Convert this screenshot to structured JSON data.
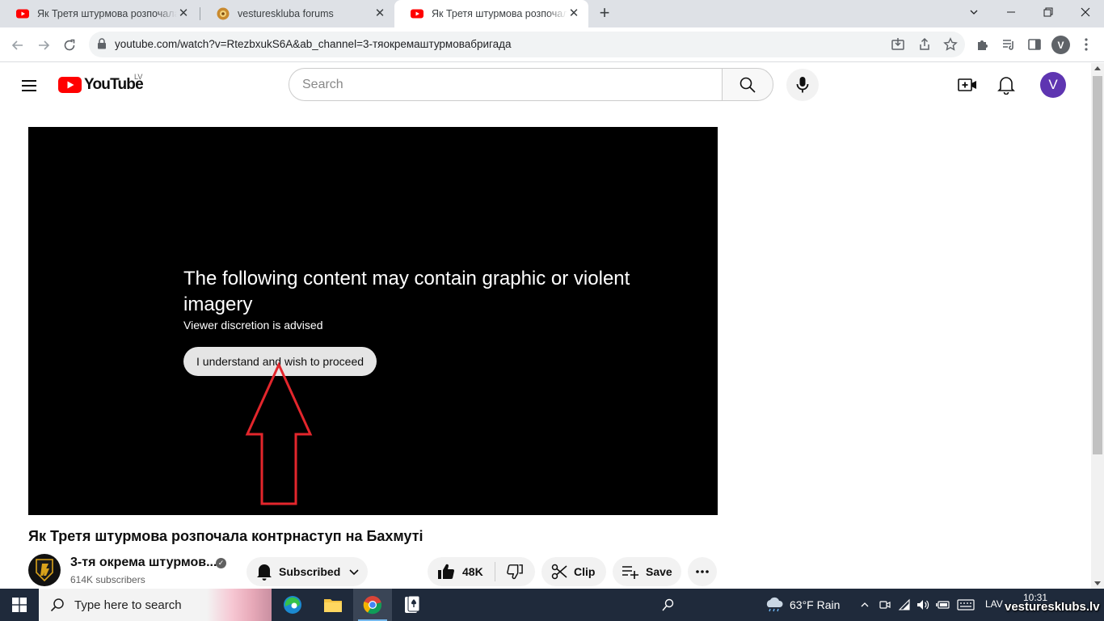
{
  "browser": {
    "tabs": [
      {
        "title": "Як Третя штурмова розпочала контрнаступ",
        "favicon": "youtube-favicon",
        "active": false
      },
      {
        "title": "vesturesklubа forums",
        "favicon": "forum-favicon",
        "active": false
      },
      {
        "title": "Як Третя штурмова розпочала контрнаступ",
        "favicon": "youtube-favicon",
        "active": true
      }
    ],
    "url": "youtube.com/watch?v=RtezbxukS6A&ab_channel=3-тяокремаштурмовабригада"
  },
  "youtube": {
    "country_code": "LV",
    "search_placeholder": "Search",
    "avatar_letter": "V"
  },
  "player": {
    "warning_title": "The following content may contain graphic or violent imagery",
    "warning_subtitle": "Viewer discretion is advised",
    "proceed_label": "I understand and wish to proceed"
  },
  "video": {
    "title": "Як Третя штурмова розпочала контрнаступ на Бахмуті",
    "channel_name": "3-тя окрема штурмов...",
    "subscribers": "614K subscribers",
    "subscribed_label": "Subscribed",
    "likes": "48K",
    "clip_label": "Clip",
    "save_label": "Save"
  },
  "taskbar": {
    "search_placeholder": "Type here to search",
    "weather": "63°F  Rain",
    "language": "LAV",
    "time": "10:31",
    "watermark": "vestureskIubs.lv"
  },
  "colors": {
    "youtube_red": "#ff0000",
    "annotation_red": "#e3262c",
    "player_bg": "#000000",
    "avatar_purple": "#5e35b1"
  }
}
